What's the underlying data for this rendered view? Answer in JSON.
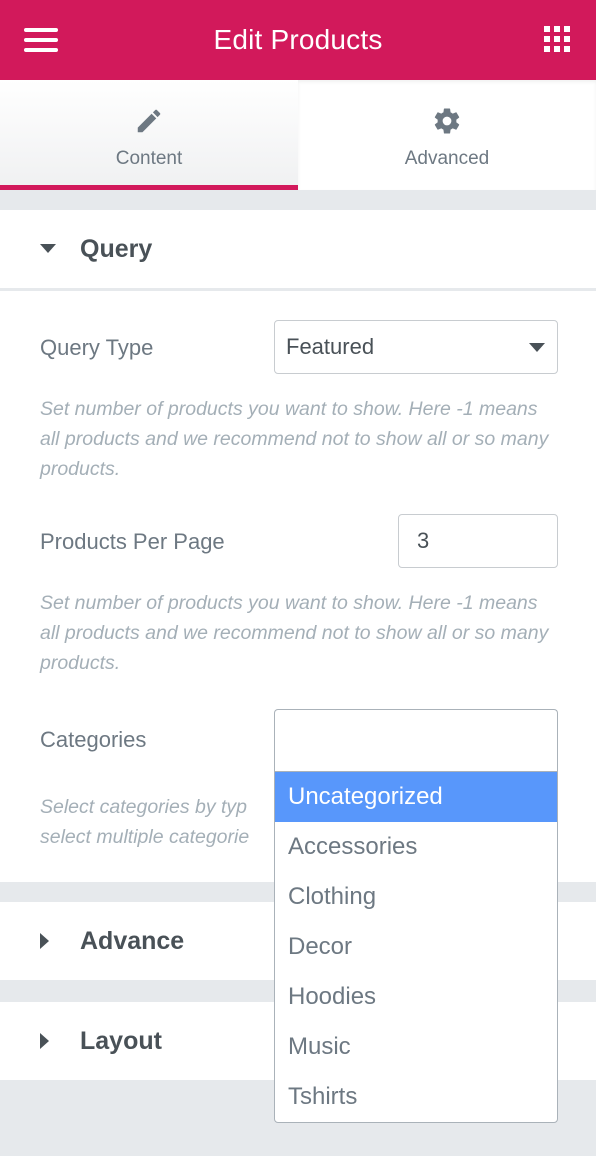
{
  "header": {
    "title": "Edit Products",
    "menu_icon": "hamburger-icon",
    "apps_icon": "grid-icon",
    "color": "#d2195b"
  },
  "tabs": [
    {
      "label": "Content",
      "icon": "pencil-icon",
      "active": true
    },
    {
      "label": "Advanced",
      "icon": "gear-icon",
      "active": false
    }
  ],
  "sections": {
    "query": {
      "label": "Query",
      "expanded": true
    },
    "advance": {
      "label": "Advance",
      "expanded": false
    },
    "layout": {
      "label": "Layout",
      "expanded": false
    }
  },
  "query": {
    "query_type": {
      "label": "Query Type",
      "value": "Featured",
      "description": "Set number of products you want to show. Here -1 means all products and we recommend not to show all or so many products."
    },
    "per_page": {
      "label": "Products Per Page",
      "value": "3",
      "description": "Set number of products you want to show. Here -1 means all products and we recommend not to show all or so many products."
    },
    "categories": {
      "label": "Categories",
      "description_line1": "Select categories by typ",
      "description_line2": "select multiple categorie",
      "options": [
        "Uncategorized",
        "Accessories",
        "Clothing",
        "Decor",
        "Hoodies",
        "Music",
        "Tshirts"
      ],
      "highlighted": "Uncategorized",
      "highlight_color": "#5897fb"
    }
  }
}
